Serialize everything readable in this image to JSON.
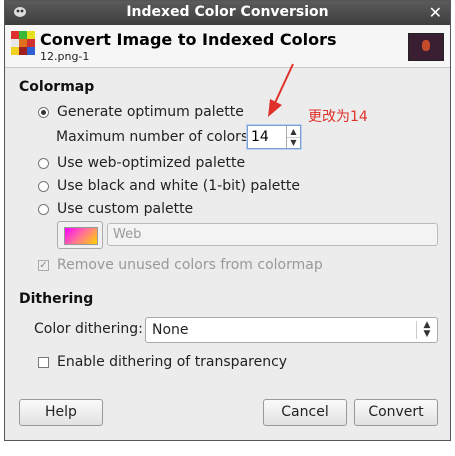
{
  "window": {
    "title": "Indexed Color Conversion"
  },
  "header": {
    "title": "Convert Image to Indexed Colors",
    "subtitle": "12.png-1"
  },
  "colormap": {
    "heading": "Colormap",
    "options": [
      "Generate optimum palette",
      "Use web-optimized palette",
      "Use black and white (1-bit) palette",
      "Use custom palette"
    ],
    "selected_index": 0,
    "max_colors_label": "Maximum number of colors:",
    "max_colors_value": "14",
    "annotation": "更改为14",
    "custom_palette_name": "Web",
    "remove_unused_label": "Remove unused colors from colormap",
    "remove_unused_checked": true
  },
  "dithering": {
    "heading": "Dithering",
    "color_dithering_label": "Color dithering:",
    "color_dithering_value": "None",
    "transparency_label": "Enable dithering of transparency",
    "transparency_checked": false
  },
  "buttons": {
    "help": "Help",
    "cancel": "Cancel",
    "convert": "Convert"
  },
  "colors": {
    "annotation_red": "#e0302a",
    "focus_blue": "#7a9fd3",
    "titlebar": "#4a4a4a"
  }
}
